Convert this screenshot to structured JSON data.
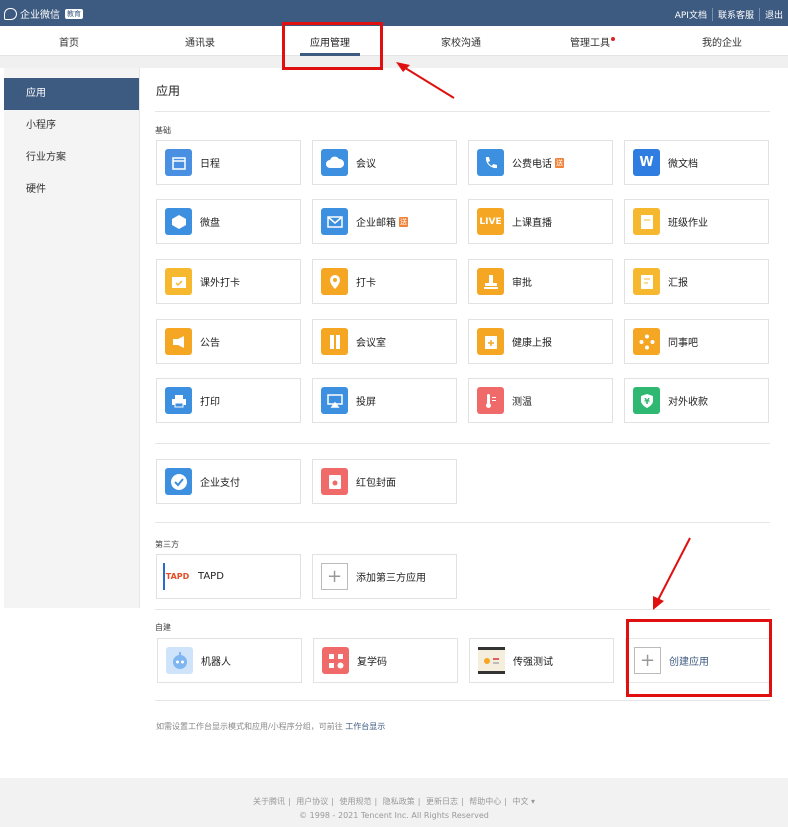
{
  "topbar": {
    "brand": "企业微信",
    "brand_tag": "教育",
    "links": [
      "API文档",
      "联系客服",
      "退出"
    ]
  },
  "nav": {
    "items": [
      "首页",
      "通讯录",
      "应用管理",
      "家校沟通",
      "管理工具",
      "我的企业"
    ],
    "active": "应用管理"
  },
  "sidebar": {
    "items": [
      "应用",
      "小程序",
      "行业方案",
      "硬件"
    ]
  },
  "main": {
    "title": "应用",
    "basic_label": "基础",
    "basic_apps": [
      {
        "label": "日程",
        "icon": "calendar-icon",
        "color": "#4a90e2",
        "badge": ""
      },
      {
        "label": "会议",
        "icon": "cloud-meeting-icon",
        "color": "#3d8fe0",
        "badge": ""
      },
      {
        "label": "公费电话",
        "icon": "phone-icon",
        "color": "#3d8fe0",
        "badge": "送"
      },
      {
        "label": "微文档",
        "icon": "w-doc-icon",
        "color": "#2f7de1",
        "badge": ""
      },
      {
        "label": "微盘",
        "icon": "cube-disk-icon",
        "color": "#3d8fe0",
        "badge": ""
      },
      {
        "label": "企业邮箱",
        "icon": "mail-icon",
        "color": "#3d8fe0",
        "badge": "送"
      },
      {
        "label": "上课直播",
        "icon": "live-icon",
        "color": "#f5a623",
        "badge": ""
      },
      {
        "label": "班级作业",
        "icon": "homework-icon",
        "color": "#f5b82e",
        "badge": ""
      },
      {
        "label": "课外打卡",
        "icon": "checkin-calendar-icon",
        "color": "#f5b82e",
        "badge": ""
      },
      {
        "label": "打卡",
        "icon": "location-pin-icon",
        "color": "#f5a623",
        "badge": ""
      },
      {
        "label": "审批",
        "icon": "stamp-icon",
        "color": "#f5a623",
        "badge": ""
      },
      {
        "label": "汇报",
        "icon": "report-icon",
        "color": "#f5b82e",
        "badge": ""
      },
      {
        "label": "公告",
        "icon": "megaphone-icon",
        "color": "#f5a623",
        "badge": ""
      },
      {
        "label": "会议室",
        "icon": "door-icon",
        "color": "#f5a623",
        "badge": ""
      },
      {
        "label": "健康上报",
        "icon": "health-icon",
        "color": "#f5a623",
        "badge": ""
      },
      {
        "label": "同事吧",
        "icon": "diamond-network-icon",
        "color": "#f5a623",
        "badge": ""
      },
      {
        "label": "打印",
        "icon": "printer-icon",
        "color": "#3d8fe0",
        "badge": ""
      },
      {
        "label": "投屏",
        "icon": "screen-cast-icon",
        "color": "#3d8fe0",
        "badge": ""
      },
      {
        "label": "测温",
        "icon": "thermometer-icon",
        "color": "#f06a6a",
        "badge": ""
      },
      {
        "label": "对外收款",
        "icon": "yuan-shield-icon",
        "color": "#2eb872",
        "badge": ""
      }
    ],
    "extra_apps": [
      {
        "label": "企业支付",
        "icon": "pay-check-icon",
        "color": "#3d8fe0"
      },
      {
        "label": "红包封面",
        "icon": "red-envelope-icon",
        "color": "#f06a6a"
      }
    ],
    "third_party_label": "第三方",
    "third_party": [
      {
        "label": "TAPD",
        "icon": "tapd-logo-icon",
        "logo_text": "TAPD"
      },
      {
        "label": "添加第三方应用",
        "icon": "plus-icon"
      }
    ],
    "custom_label": "自建",
    "custom_apps": [
      {
        "label": "机器人",
        "icon": "robot-icon",
        "color": "#7fb6f0"
      },
      {
        "label": "复学码",
        "icon": "qr-code-icon",
        "color": "#f06a6a"
      },
      {
        "label": "传强测试",
        "icon": "thumbnail-icon",
        "color": "#e8d9b8"
      },
      {
        "label": "创建应用",
        "icon": "plus-icon",
        "color": "#ffffff"
      }
    ],
    "hint_text": "如需设置工作台显示模式和应用/小程序分组，可前往",
    "hint_link": "工作台显示"
  },
  "footer": {
    "links": [
      "关于腾讯",
      "用户协议",
      "使用规范",
      "隐私政策",
      "更新日志",
      "帮助中心",
      "中文 ▾"
    ],
    "copyright": "© 1998 - 2021 Tencent Inc. All Rights Reserved"
  }
}
